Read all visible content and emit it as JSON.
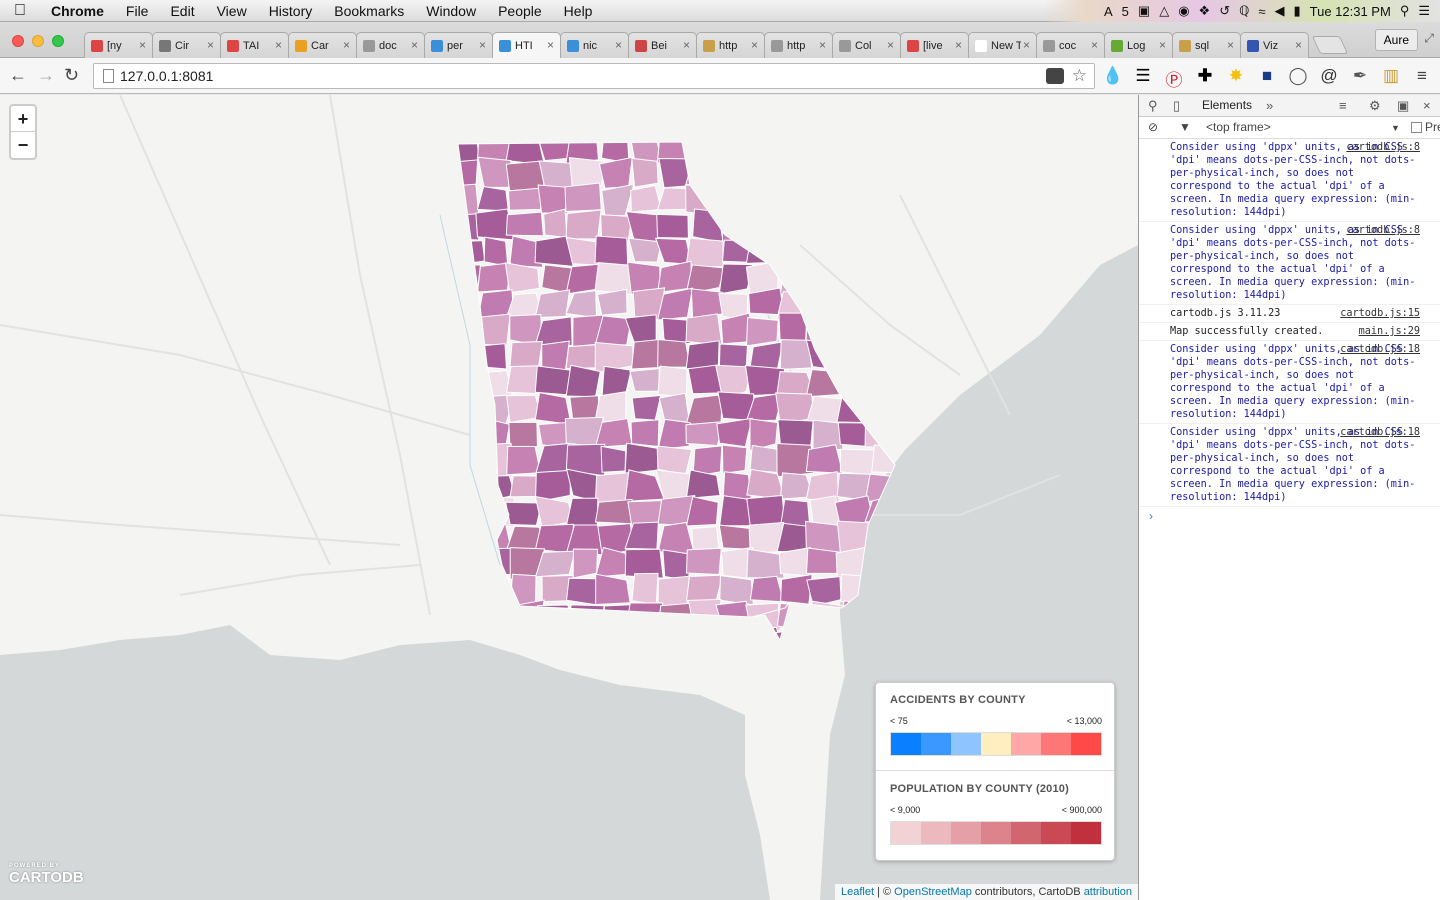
{
  "menubar": {
    "apple": "",
    "items": [
      "Chrome",
      "File",
      "Edit",
      "View",
      "History",
      "Bookmarks",
      "Window",
      "People",
      "Help"
    ],
    "tray_badge": "5",
    "clock": "Tue 12:31 PM"
  },
  "tabs": [
    {
      "label": "[ny",
      "color": "#d44"
    },
    {
      "label": "Cir",
      "color": "#777"
    },
    {
      "label": "TAI",
      "color": "#d44"
    },
    {
      "label": "Car",
      "color": "#e9a023"
    },
    {
      "label": "doc",
      "color": "#999"
    },
    {
      "label": "per",
      "color": "#3a8fd8"
    },
    {
      "label": "HTI",
      "color": "#3a8fd8",
      "active": true
    },
    {
      "label": "nic",
      "color": "#3a8fd8"
    },
    {
      "label": "Bei",
      "color": "#c44"
    },
    {
      "label": "http",
      "color": "#c9a04a"
    },
    {
      "label": "http",
      "color": "#999"
    },
    {
      "label": "Col",
      "color": "#999"
    },
    {
      "label": "[live",
      "color": "#d44"
    },
    {
      "label": "New T",
      "color": "#fff"
    },
    {
      "label": "coc",
      "color": "#999"
    },
    {
      "label": "Log",
      "color": "#6a3"
    },
    {
      "label": "sql",
      "color": "#c9a04a"
    },
    {
      "label": "Viz",
      "color": "#3456b0"
    }
  ],
  "profile": "Aure",
  "address": {
    "url": "127.0.0.1:8081"
  },
  "map": {
    "zoom_in": "+",
    "zoom_out": "−",
    "logo_small": "POWERED BY",
    "logo_big": "CARTODB",
    "attribution": {
      "leaflet": "Leaflet",
      "sep": " | © ",
      "osm": "OpenStreetMap",
      "rest": " contributors, CartoDB ",
      "attr": "attribution"
    }
  },
  "legend": {
    "accidents": {
      "title": "ACCIDENTS BY COUNTY",
      "low": "< 75",
      "high": "< 13,000",
      "colors": [
        "#0a7fff",
        "#3b98ff",
        "#8ec4ff",
        "#ffeec0",
        "#ffa6a6",
        "#ff7676",
        "#ff4848"
      ]
    },
    "population": {
      "title": "POPULATION BY COUNTY (2010)",
      "low": "< 9,000",
      "high": "< 900,000",
      "colors": [
        "#f3d2d6",
        "#ecb9be",
        "#e59fa6",
        "#dc838b",
        "#d26670",
        "#c94a55",
        "#c0303d"
      ]
    }
  },
  "devtools": {
    "tab": "Elements",
    "frame": "<top frame>",
    "preserve": "Pre",
    "logs": [
      {
        "type": "warn",
        "src": "cartodb.js:8",
        "text": "Consider using 'dppx' units, as in CSS 'dpi' means dots-per-CSS-inch, not dots-per-physical-inch, so does not correspond to the actual 'dpi' of a screen. In media query expression: (min-resolution: 144dpi)"
      },
      {
        "type": "warn",
        "src": "cartodb.js:8",
        "text": "Consider using 'dppx' units, as in CSS 'dpi' means dots-per-CSS-inch, not dots-per-physical-inch, so does not correspond to the actual 'dpi' of a screen. In media query expression: (min-resolution: 144dpi)"
      },
      {
        "type": "info",
        "src": "cartodb.js:15",
        "text": "cartodb.js 3.11.23"
      },
      {
        "type": "info",
        "src": "main.js:29",
        "text": "Map successfully created."
      },
      {
        "type": "warn",
        "src": "cartodb.js:18",
        "text": "Consider using 'dppx' units, as in CSS 'dpi' means dots-per-CSS-inch, not dots-per-physical-inch, so does not correspond to the actual 'dpi' of a screen. In media query expression: (min-resolution: 144dpi)"
      },
      {
        "type": "warn",
        "src": "cartodb.js:18",
        "text": "Consider using 'dppx' units, as in CSS 'dpi' means dots-per-CSS-inch, not dots-per-physical-inch, so does not correspond to the actual 'dpi' of a screen. In media query expression: (min-resolution: 144dpi)"
      }
    ],
    "prompt": "›"
  }
}
